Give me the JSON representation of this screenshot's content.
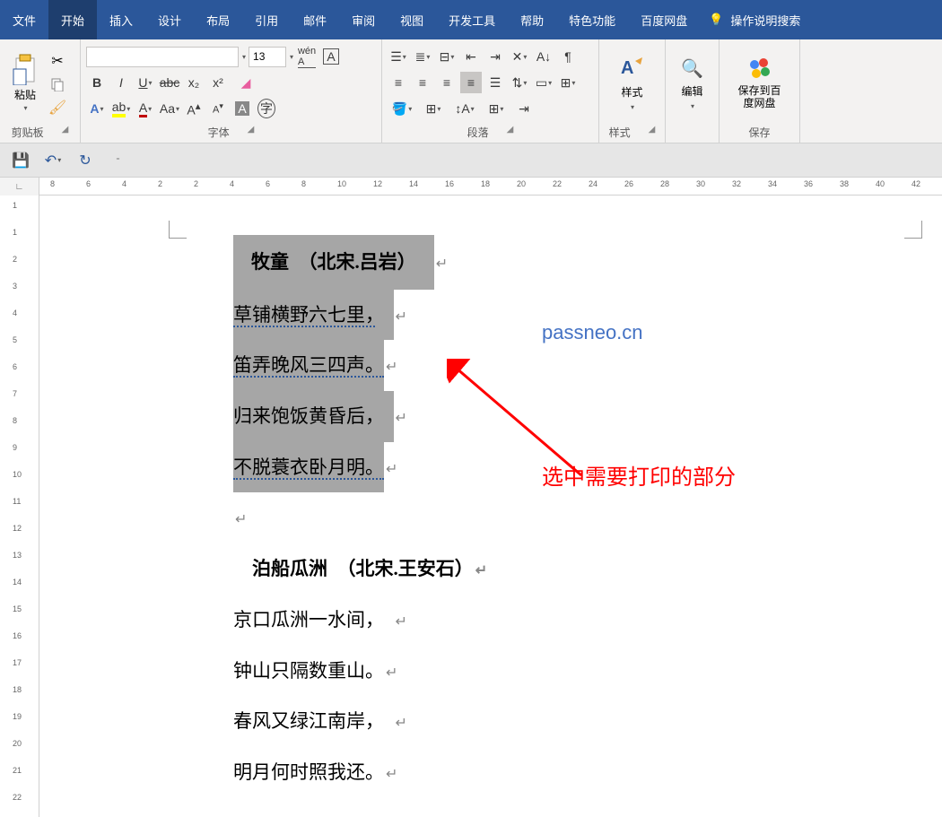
{
  "menubar": {
    "items": [
      "文件",
      "开始",
      "插入",
      "设计",
      "布局",
      "引用",
      "邮件",
      "审阅",
      "视图",
      "开发工具",
      "帮助",
      "特色功能",
      "百度网盘"
    ],
    "active_index": 1,
    "search_placeholder": "操作说明搜索"
  },
  "ribbon": {
    "clipboard": {
      "paste": "粘贴",
      "label": "剪贴板"
    },
    "font": {
      "label": "字体",
      "size": "13",
      "font_name": ""
    },
    "paragraph": {
      "label": "段落"
    },
    "styles": {
      "btn": "样式",
      "label": "样式"
    },
    "editing": {
      "btn": "编辑"
    },
    "save": {
      "btn": "保存到百度网盘",
      "label": "保存"
    }
  },
  "ruler": {
    "h_marks": [
      "8",
      "6",
      "4",
      "2",
      "2",
      "4",
      "6",
      "8",
      "10",
      "12",
      "14",
      "16",
      "18",
      "20",
      "22",
      "24",
      "26",
      "28",
      "30",
      "32",
      "34",
      "36",
      "38",
      "40",
      "42"
    ],
    "v_marks": [
      "1",
      "1",
      "2",
      "3",
      "4",
      "5",
      "6",
      "7",
      "8",
      "9",
      "10",
      "11",
      "12",
      "13",
      "14",
      "15",
      "16",
      "17",
      "18",
      "19",
      "20",
      "21",
      "22"
    ]
  },
  "document": {
    "poem1_title": "牧童　（北宋.吕岩）",
    "poem1_lines": [
      "草铺横野六七里，",
      "笛弄晚风三四声。",
      "归来饱饭黄昏后，",
      "不脱蓑衣卧月明。"
    ],
    "poem2_title": "泊船瓜洲　（北宋.王安石）",
    "poem2_lines": [
      "京口瓜洲一水间，",
      "钟山只隔数重山。",
      "春风又绿江南岸，",
      "明月何时照我还。"
    ]
  },
  "annotations": {
    "watermark": "passneo.cn",
    "callout": "选中需要打印的部分"
  }
}
